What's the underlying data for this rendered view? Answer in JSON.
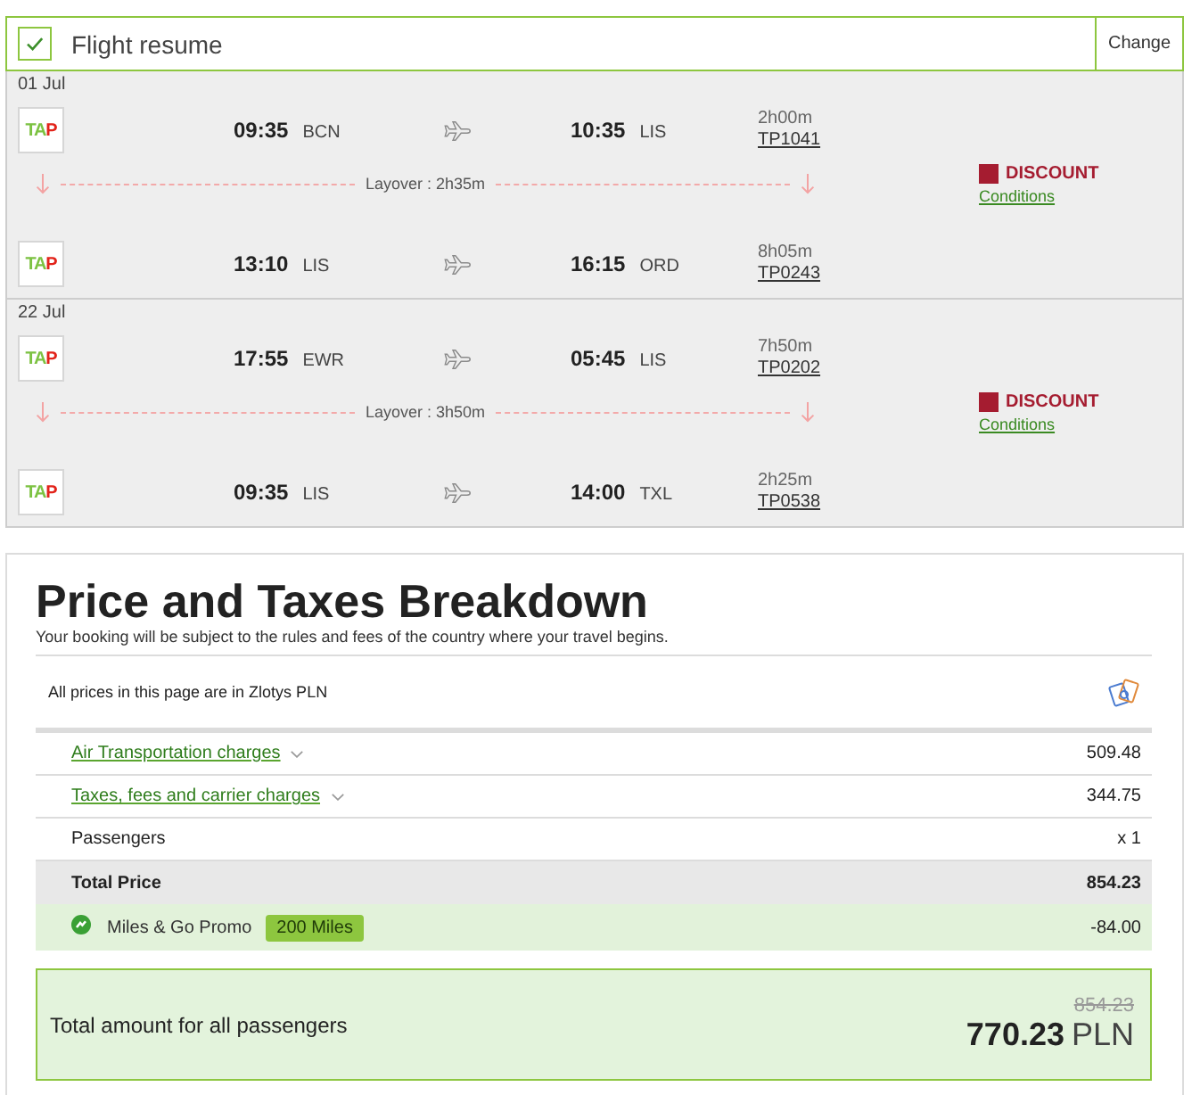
{
  "flight_resume": {
    "title": "Flight resume",
    "checked": true,
    "change_button": "Change"
  },
  "journeys": [
    {
      "date": "01 Jul",
      "segments": [
        {
          "airline_logo": "TAP",
          "departure_time": "09:35",
          "origin": "BCN",
          "arrival_time": "10:35",
          "destination": "LIS",
          "duration": "2h00m",
          "flight_number": "TP1041"
        },
        {
          "airline_logo": "TAP",
          "departure_time": "13:10",
          "origin": "LIS",
          "arrival_time": "16:15",
          "destination": "ORD",
          "duration": "8h05m",
          "flight_number": "TP0243"
        }
      ],
      "layovers": [
        "Layover : 2h35m"
      ],
      "fare": {
        "label": "DISCOUNT",
        "link": "Conditions"
      }
    },
    {
      "date": "22 Jul",
      "segments": [
        {
          "airline_logo": "TAP",
          "departure_time": "17:55",
          "origin": "EWR",
          "arrival_time": "05:45",
          "destination": "LIS",
          "duration": "7h50m",
          "flight_number": "TP0202"
        },
        {
          "airline_logo": "TAP",
          "departure_time": "09:35",
          "origin": "LIS",
          "arrival_time": "14:00",
          "destination": "TXL",
          "duration": "2h25m",
          "flight_number": "TP0538"
        }
      ],
      "layovers": [
        "Layover : 3h50m"
      ],
      "fare": {
        "label": "DISCOUNT",
        "link": "Conditions"
      }
    }
  ],
  "price_breakdown": {
    "title": "Price and Taxes Breakdown",
    "subtitle": "Your booking will be subject to the rules and fees of the country where your travel begins.",
    "currency_note": "All prices in this page are in Zlotys PLN",
    "rows": [
      {
        "kind": "expandable",
        "label": "Air Transportation charges",
        "value": "509.48",
        "expanded": false
      },
      {
        "kind": "expandable",
        "label": "Taxes, fees and carrier charges",
        "value": "344.75",
        "expanded": false
      },
      {
        "kind": "plain",
        "label": "Passengers",
        "value": "x 1"
      },
      {
        "kind": "total",
        "label": "Total Price",
        "value": "854.23"
      },
      {
        "kind": "promo",
        "label": "Miles & Go Promo",
        "badge": "200 Miles",
        "value": "-84.00"
      }
    ]
  },
  "total": {
    "label": "Total amount for all passengers",
    "old_amount": "854.23",
    "amount": "770.23",
    "currency": "PLN"
  }
}
